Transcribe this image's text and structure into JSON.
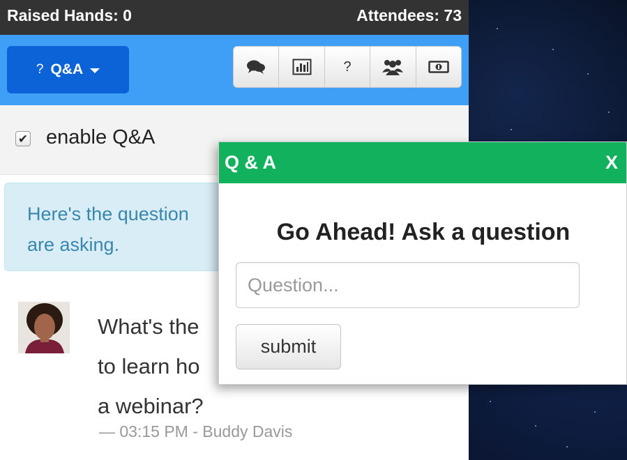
{
  "topbar": {
    "raised_hands": "Raised Hands: 0",
    "attendees": "Attendees: 73"
  },
  "toolbar": {
    "dropdown": {
      "icon_glyph": "?",
      "label": "Q&A"
    },
    "buttons": [
      {
        "icon": "chat-icon"
      },
      {
        "icon": "poll-chart-icon"
      },
      {
        "icon": "question-icon",
        "glyph": "?"
      },
      {
        "icon": "group-icon"
      },
      {
        "icon": "money-icon"
      }
    ]
  },
  "enable": {
    "checked": true,
    "label": "enable Q&A"
  },
  "alert": {
    "text": "Here's the question are asking."
  },
  "alert_lines": {
    "line1": "Here's the question",
    "line2": "are asking."
  },
  "question": {
    "lines": [
      "What's the",
      "to learn ho",
      "a webinar?"
    ],
    "meta": "— 03:15 PM - Buddy Davis"
  },
  "modal": {
    "title": "Q & A",
    "close": "X",
    "heading": "Go Ahead! Ask a question",
    "input_placeholder": "Question...",
    "input_value": "",
    "submit_label": "submit"
  },
  "colors": {
    "topbar": "#333333",
    "bluebar": "#3f9ef5",
    "dropdown": "#0c63d8",
    "modal_header": "#12b15d",
    "alert_bg": "#d9edf7",
    "alert_text": "#3a87ad"
  }
}
